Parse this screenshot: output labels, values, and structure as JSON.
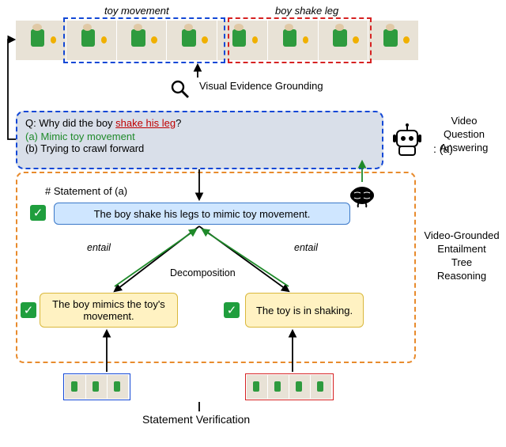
{
  "captions": {
    "toy": "toy movement",
    "leg": "boy shake leg"
  },
  "evidence_label": "Visual Evidence Grounding",
  "qa": {
    "q_prefix": "Q: Why did the boy ",
    "q_action": "shake his leg",
    "q_suffix": "?",
    "ans_a": "(a) Mimic toy movement",
    "ans_b": "(b) Trying to crawl forward",
    "robot_answer": ": (a)"
  },
  "tree": {
    "stmt_title": "# Statement of (a)",
    "root": "The boy shake his legs to mimic toy movement.",
    "child_a": "The boy mimics the toy's movement.",
    "child_b": "The toy is in shaking.",
    "entail": "entail",
    "decomp": "Decomposition"
  },
  "sv_label": "Statement Verification",
  "side": {
    "vqa1": "Video",
    "vqa2": "Question",
    "vqa3": "Answering",
    "tree1": "Video-Grounded",
    "tree2": "Entailment",
    "tree3": "Tree",
    "tree4": "Reasoning"
  },
  "icons": {
    "check": "✓"
  }
}
